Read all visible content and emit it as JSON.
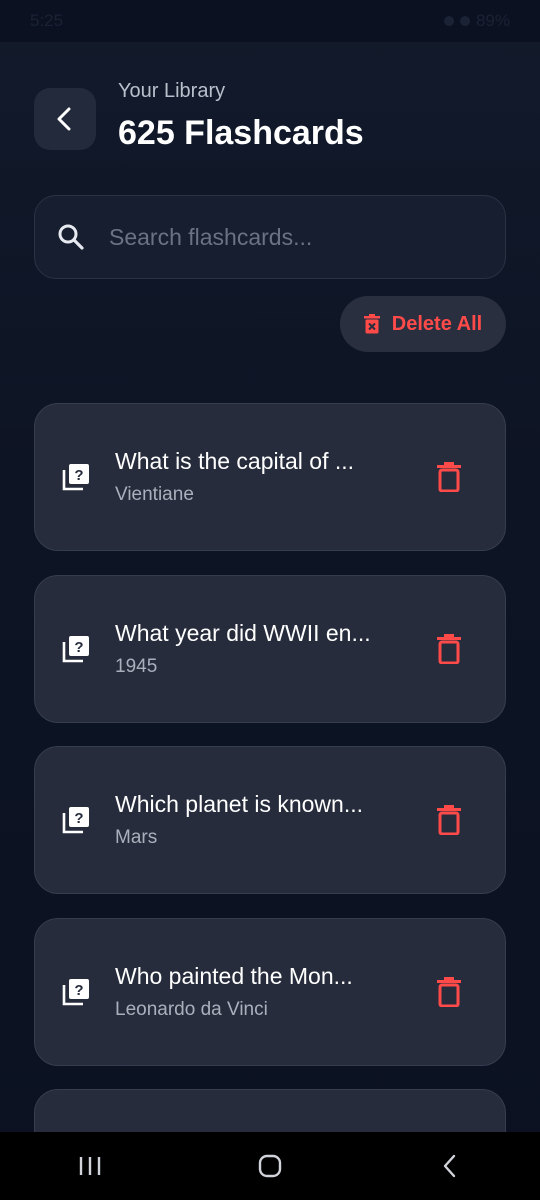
{
  "status_bar": {
    "time": "5:25",
    "battery": "89%"
  },
  "header": {
    "subtitle": "Your Library",
    "title": "625 Flashcards"
  },
  "search": {
    "placeholder": "Search flashcards..."
  },
  "actions": {
    "delete_all_label": "Delete All"
  },
  "flashcards": [
    {
      "question": "What is the capital of ...",
      "answer": "Vientiane"
    },
    {
      "question": "What year did WWII en...",
      "answer": "1945"
    },
    {
      "question": "Which planet is known...",
      "answer": "Mars"
    },
    {
      "question": "Who painted the Mon...",
      "answer": "Leonardo da Vinci"
    }
  ],
  "colors": {
    "accent_delete": "#ff4a4a",
    "card_bg": "#262c3c",
    "screen_bg": "#0e1526"
  },
  "icons": {
    "back": "chevron-left-icon",
    "search": "search-icon",
    "delete_all": "trash-x-icon",
    "card": "flashcard-question-icon",
    "card_delete": "trash-icon"
  }
}
